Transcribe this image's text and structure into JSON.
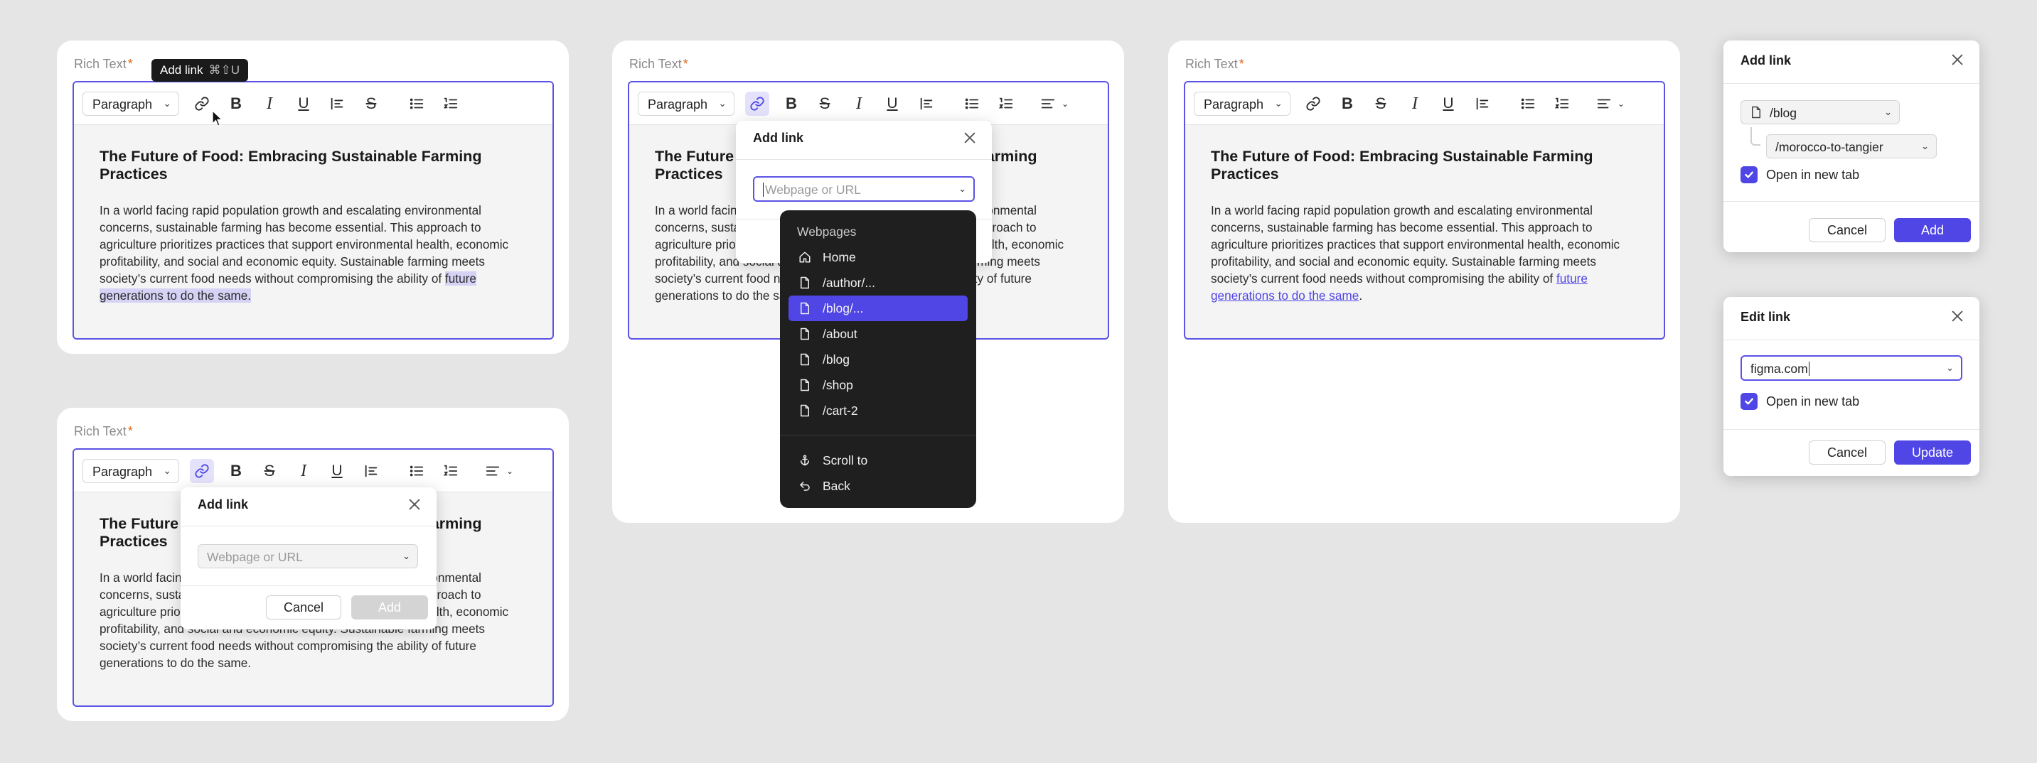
{
  "field": {
    "label": "Rich Text",
    "required_mark": "*"
  },
  "toolbar": {
    "paragraph_select": "Paragraph",
    "tooltip_label": "Add link",
    "tooltip_shortcut": "⌘⇧U",
    "icons": [
      "link-icon",
      "bold-icon",
      "italic-icon",
      "underline-icon",
      "strikethrough-icon",
      "blockquote-icon",
      "bullet-list-icon",
      "numbered-list-icon",
      "align-left-icon"
    ]
  },
  "article": {
    "title": "The Future of Food: Embracing Sustainable Farming Practices",
    "body_main": "In a world facing rapid population growth and escalating environmental concerns, sustainable farming has become essential. This approach to agriculture prioritizes practices that support environmental health, economic profitability, and social and economic equity. Sustainable farming meets society’s current food needs without compromising the ability of",
    "body_tail": "future generations to do the same.",
    "body_tail_link": "future generations to do the same",
    "period": "."
  },
  "add_link_popover": {
    "title": "Add link",
    "placeholder": "Webpage or URL",
    "cancel_label": "Cancel",
    "add_label": "Add"
  },
  "link_dropdown": {
    "section_label": "Webpages",
    "items": [
      {
        "label": "Home",
        "icon": "home-icon"
      },
      {
        "label": "/author/...",
        "icon": "page-icon"
      },
      {
        "label": "/blog/...",
        "icon": "page-icon",
        "selected": true
      },
      {
        "label": "/about",
        "icon": "page-icon"
      },
      {
        "label": "/blog",
        "icon": "page-icon"
      },
      {
        "label": "/shop",
        "icon": "page-icon"
      },
      {
        "label": "/cart-2",
        "icon": "page-icon"
      }
    ],
    "scroll_to_label": "Scroll to",
    "back_label": "Back"
  },
  "add_link_panel": {
    "title": "Add link",
    "page_value": "/blog",
    "subpage_value": "/morocco-to-tangier",
    "open_new_tab_label": "Open in new tab",
    "open_new_tab_checked": true,
    "cancel_label": "Cancel",
    "add_label": "Add"
  },
  "edit_link_panel": {
    "title": "Edit link",
    "url_value": "figma.com",
    "open_new_tab_label": "Open in new tab",
    "open_new_tab_checked": true,
    "cancel_label": "Cancel",
    "update_label": "Update"
  },
  "colors": {
    "accent": "#4f46e5",
    "highlight": "#d5d2f6",
    "required": "#e0661b",
    "dropdown_bg": "#1f1f1f"
  }
}
